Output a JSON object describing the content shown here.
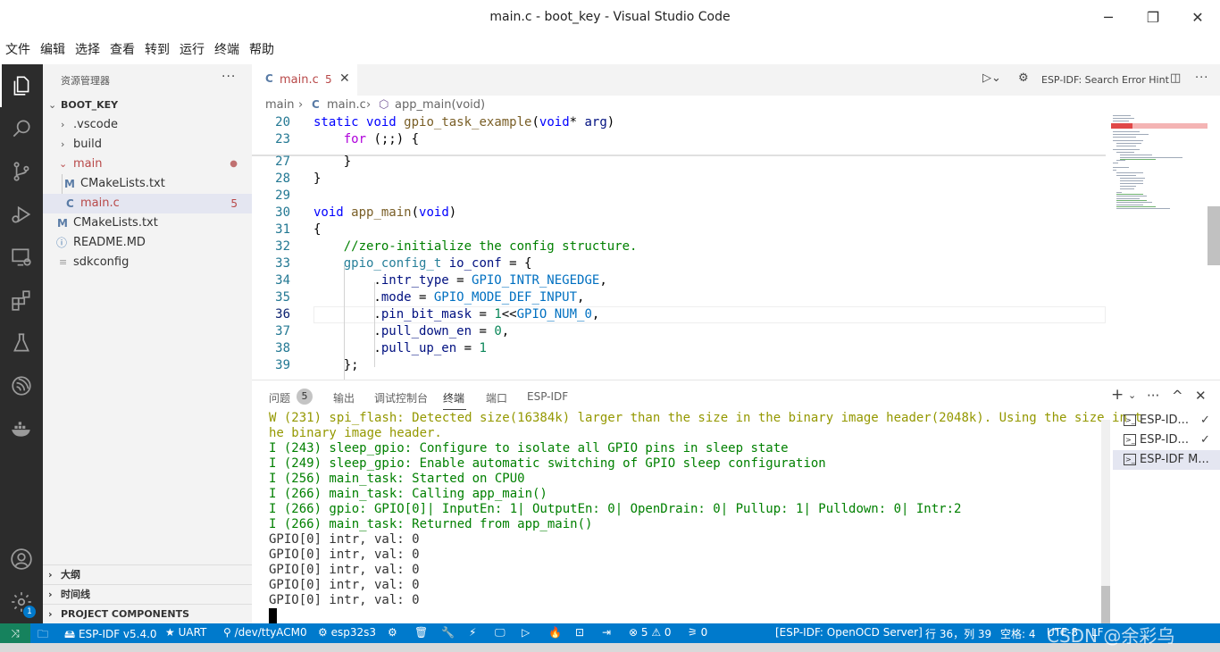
{
  "window": {
    "title": "main.c - boot_key - Visual Studio Code",
    "minimize": "─",
    "maximize": "❐",
    "close": "✕"
  },
  "menu": [
    "文件",
    "编辑",
    "选择",
    "查看",
    "转到",
    "运行",
    "终端",
    "帮助"
  ],
  "activity_bar": {
    "items": [
      "explorer-icon",
      "search-icon",
      "source-control-icon",
      "run-debug-icon",
      "remote-explorer-icon",
      "extensions-icon",
      "testing-icon",
      "esp-idf-icon",
      "docker-icon"
    ],
    "bottom": [
      "account-icon",
      "settings-icon"
    ],
    "settings_badge": "1"
  },
  "sidebar": {
    "title": "资源管理器",
    "more": "···",
    "root": "BOOT_KEY",
    "items": [
      {
        "name": ".vscode",
        "twisty": "›",
        "icon": ""
      },
      {
        "name": "build",
        "twisty": "›",
        "icon": ""
      },
      {
        "name": "main",
        "twisty": "⌄",
        "icon": "",
        "dot": "●"
      },
      {
        "name": "CMakeLists.txt",
        "icon": "M"
      },
      {
        "name": "main.c",
        "icon": "C",
        "count": "5"
      },
      {
        "name": "CMakeLists.txt",
        "icon": "M"
      },
      {
        "name": "README.MD",
        "icon": "ⓘ"
      },
      {
        "name": "sdkconfig",
        "icon": "≡"
      }
    ],
    "sections": [
      "大纲",
      "时间线",
      "PROJECT COMPONENTS"
    ]
  },
  "tab": {
    "icon": "C",
    "name": "main.c",
    "count": "5",
    "close": "✕"
  },
  "editor_actions": {
    "search_hint": "ESP-IDF: Search Error Hint"
  },
  "breadcrumb": {
    "folder": "main",
    "sep": "›",
    "file": "main.c",
    "symbol": "app_main(void)"
  },
  "editor": {
    "lines": [
      {
        "n": "20",
        "text": "static void gpio_task_example(void* arg)"
      },
      {
        "n": "23",
        "text": "    for (;;) {"
      },
      {
        "n": "27",
        "text": "    }"
      },
      {
        "n": "28",
        "text": "}"
      },
      {
        "n": "29",
        "text": ""
      },
      {
        "n": "30",
        "text": "void app_main(void)"
      },
      {
        "n": "31",
        "text": "{"
      },
      {
        "n": "32",
        "text": "    //zero-initialize the config structure."
      },
      {
        "n": "33",
        "text": "    gpio_config_t io_conf = {"
      },
      {
        "n": "34",
        "text": "        .intr_type = GPIO_INTR_NEGEDGE,"
      },
      {
        "n": "35",
        "text": "        .mode = GPIO_MODE_DEF_INPUT,"
      },
      {
        "n": "36",
        "text": "        .pin_bit_mask = 1<<GPIO_NUM_0,"
      },
      {
        "n": "37",
        "text": "        .pull_down_en = 0,"
      },
      {
        "n": "38",
        "text": "        .pull_up_en = 1"
      },
      {
        "n": "39",
        "text": "    };"
      }
    ]
  },
  "panel": {
    "tabs": [
      "问题",
      "输出",
      "调试控制台",
      "终端",
      "端口",
      "ESP-IDF"
    ],
    "problems_count": "5",
    "actions": [
      "+",
      "⌄",
      "···",
      "^",
      "✕"
    ],
    "terminal_lines": [
      {
        "t": "W (231) spi_flash: Detected size(16384k) larger than the size in the binary image header(2048k). Using the size in t",
        "k": "warn"
      },
      {
        "t": "he binary image header.",
        "k": "warn"
      },
      {
        "t": "I (243) sleep_gpio: Configure to isolate all GPIO pins in sleep state",
        "k": "info"
      },
      {
        "t": "I (249) sleep_gpio: Enable automatic switching of GPIO sleep configuration",
        "k": "info"
      },
      {
        "t": "I (256) main_task: Started on CPU0",
        "k": "info"
      },
      {
        "t": "I (266) main_task: Calling app_main()",
        "k": "info"
      },
      {
        "t": "I (266) gpio: GPIO[0]| InputEn: 1| OutputEn: 0| OpenDrain: 0| Pullup: 1| Pulldown: 0| Intr:2",
        "k": "info"
      },
      {
        "t": "I (266) main_task: Returned from app_main()",
        "k": "info"
      },
      {
        "t": "GPIO[0] intr, val: 0",
        "k": "plain"
      },
      {
        "t": "GPIO[0] intr, val: 0",
        "k": "plain"
      },
      {
        "t": "GPIO[0] intr, val: 0",
        "k": "plain"
      },
      {
        "t": "GPIO[0] intr, val: 0",
        "k": "plain"
      },
      {
        "t": "GPIO[0] intr, val: 0",
        "k": "plain"
      }
    ],
    "terminals": [
      {
        "name": "ESP-ID...",
        "check": "✓"
      },
      {
        "name": "ESP-ID...",
        "check": "✓"
      },
      {
        "name": "ESP-IDF M...",
        "check": ""
      }
    ]
  },
  "statusbar": {
    "remote": "⤨",
    "idf": "ESP-IDF v5.4.0",
    "uart": "UART",
    "port": "/dev/ttyACM0",
    "target": "esp32s3",
    "problems": "⊗ 5 ⚠ 0",
    "ports": "0",
    "openocd": "[ESP-IDF: OpenOCD Server]",
    "position": "行 36，列 39",
    "spaces": "空格: 4",
    "encoding": "UTF-8",
    "eol": "LF"
  },
  "watermark": "CSDN @余彩乌",
  "colors": {
    "accent": "#007acc",
    "remote": "#16825d",
    "activity": "#2c2c2c",
    "error": "#b84848"
  }
}
